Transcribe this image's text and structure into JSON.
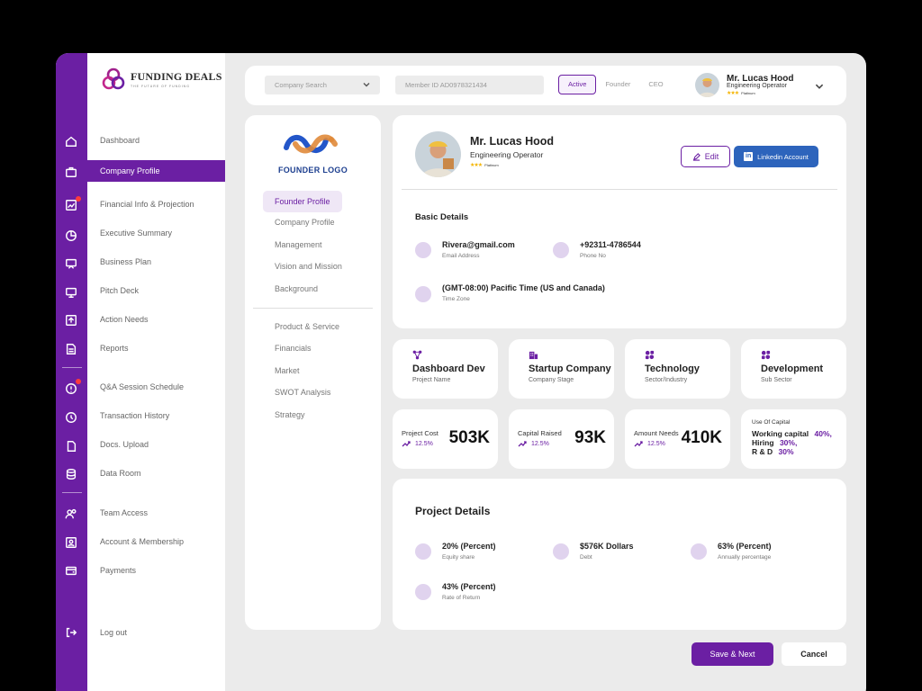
{
  "brand": {
    "name": "FUNDING DEALS",
    "tagline": "THE FUTURE OF FUNDING"
  },
  "nav": {
    "items": [
      {
        "label": "Dashboard"
      },
      {
        "label": "Company Profile"
      },
      {
        "label": "Financial Info & Projection"
      },
      {
        "label": "Executive Summary"
      },
      {
        "label": "Business Plan"
      },
      {
        "label": "Pitch Deck"
      },
      {
        "label": "Action Needs"
      },
      {
        "label": "Reports"
      },
      {
        "label": "Q&A Session Schedule"
      },
      {
        "label": "Transaction History"
      },
      {
        "label": "Docs. Upload"
      },
      {
        "label": "Data Room"
      },
      {
        "label": "Team Access"
      },
      {
        "label": "Account & Membership"
      },
      {
        "label": "Payments"
      }
    ],
    "logout": "Log out"
  },
  "topbar": {
    "search_placeholder": "Company Search",
    "member_id": "Member ID AD0978321434",
    "tabs": [
      "Active",
      "Founder",
      "CEO"
    ],
    "user": {
      "name": "Mr. Lucas Hood",
      "role": "Engineering Operator",
      "stars": "★★★",
      "tier": "Platinum"
    }
  },
  "subnav": {
    "logo_text": "FOUNDER LOGO",
    "group1": [
      "Founder Profile",
      "Company Profile",
      "Management",
      "Vision and Mission",
      "Background"
    ],
    "group2": [
      "Product & Service",
      "Financials",
      "Market",
      "SWOT Analysis",
      "Strategy"
    ]
  },
  "profile": {
    "name": "Mr. Lucas Hood",
    "role": "Engineering Operator",
    "stars": "★★★",
    "tier": "Platinum",
    "edit_label": "Edit",
    "linkedin_label": "Linkedin Account",
    "basic_title": "Basic Details",
    "email": {
      "value": "Rivera@gmail.com",
      "label": "Email Address"
    },
    "phone": {
      "value": "+92311-4786544",
      "label": "Phone No"
    },
    "timezone": {
      "value": "(GMT-08:00) Pacific Time (US and Canada)",
      "label": "Time Zone"
    }
  },
  "tiles": [
    {
      "value": "Dashboard Dev",
      "label": "Project Name",
      "icon": "nodes-icon"
    },
    {
      "value": "Startup Company",
      "label": "Company Stage",
      "icon": "building-icon"
    },
    {
      "value": "Technology",
      "label": "Sector/Industry",
      "icon": "sector-icon"
    },
    {
      "value": "Development",
      "label": "Sub Sector",
      "icon": "subsector-icon"
    }
  ],
  "metrics": [
    {
      "label": "Project Cost",
      "trend": "12.5%",
      "value": "503K"
    },
    {
      "label": "Capital Raised",
      "trend": "12.5%",
      "value": "93K"
    },
    {
      "label": "Amount Needs",
      "trend": "12.5%",
      "value": "410K"
    }
  ],
  "use_of_capital": {
    "title": "Use Of Capital",
    "rows": [
      {
        "label": "Working capital",
        "pct": "40%,"
      },
      {
        "label": "Hiring",
        "pct": "30%,"
      },
      {
        "label": "R & D",
        "pct": "30%"
      }
    ]
  },
  "project": {
    "title": "Project Details",
    "items": [
      {
        "value": "20% (Percent)",
        "label": "Equity share"
      },
      {
        "value": "$576K Dollars",
        "label": "Debt"
      },
      {
        "value": "63% (Percent)",
        "label": "Annually percentage"
      },
      {
        "value": "43% (Percent)",
        "label": "Rate of Return"
      }
    ]
  },
  "actions": {
    "save_next": "Save & Next",
    "cancel": "Cancel"
  },
  "colors": {
    "accent": "#6b1fa3",
    "linkedin": "#2d64bc",
    "avatar_bg": "#e0d3ee",
    "alert": "#ff3b3b"
  }
}
